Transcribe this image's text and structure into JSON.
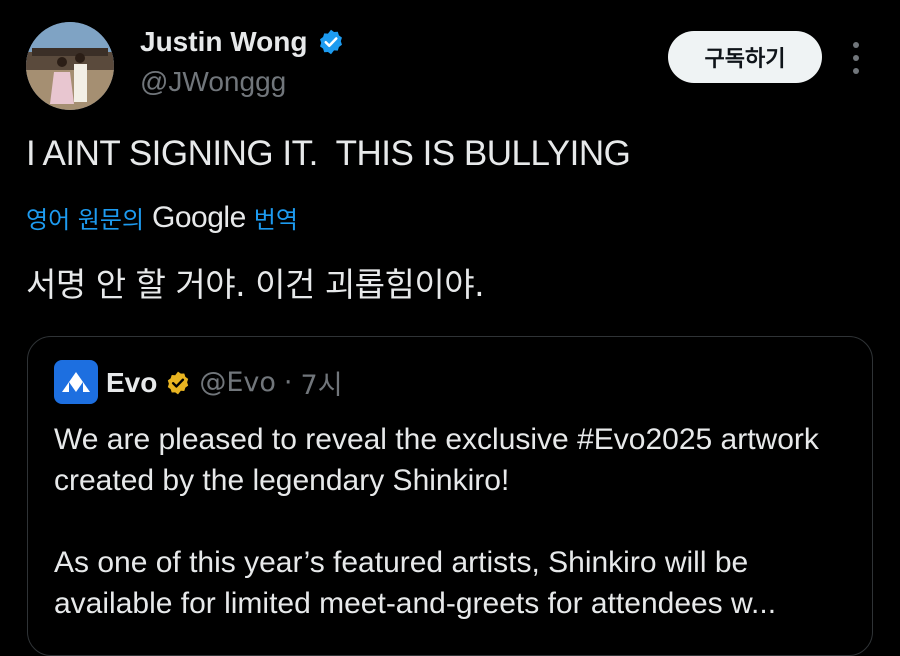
{
  "author": {
    "display_name": "Justin Wong",
    "handle": "@JWonggg",
    "verified": true,
    "verified_color": "#1d9bf0",
    "avatar_icon": "profile-photo"
  },
  "actions": {
    "subscribe_label": "구독하기",
    "more_icon": "more-vertical-icon"
  },
  "tweet": {
    "text": "I AINT SIGNING IT.  THIS IS BULLYING"
  },
  "translation": {
    "prefix": "영어 원문의",
    "brand": "Google",
    "suffix": "번역",
    "text": "서명 안 할 거야. 이건 괴롭힘이야."
  },
  "quote": {
    "display_name": "Evo",
    "verified_color": "#e8b421",
    "handle": "@Evo",
    "separator": "·",
    "time": "7시",
    "paragraph1": "We are pleased to reveal the exclusive #Evo2025 artwork created by the legendary Shinkiro!",
    "paragraph2": "As one of this year’s featured artists, Shinkiro will be available for limited meet-and-greets for attendees w..."
  },
  "colors": {
    "background": "#000000",
    "text": "#e7e9ea",
    "muted": "#71767b",
    "accent": "#1d9bf0",
    "border": "#2f3336"
  }
}
